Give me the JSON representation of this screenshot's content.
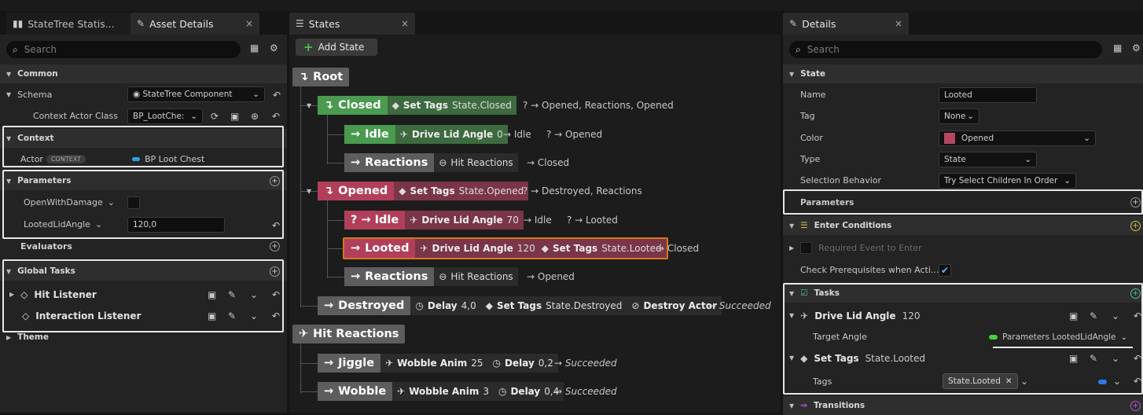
{
  "left_tabs": {
    "stats": "StateTree Statis...",
    "asset": "Asset Details",
    "close": "×"
  },
  "left": {
    "search_placeholder": "Search",
    "common": "Common",
    "schema_label": "Schema",
    "schema_value": "StateTree Component",
    "context_actor_class_label": "Context Actor Class",
    "context_actor_class_value": "BP_LootChe:",
    "context_section": "Context",
    "actor_label": "Actor",
    "actor_badge": "CONTEXT",
    "actor_value": "BP Loot Chest",
    "parameters_section": "Parameters",
    "open_with_damage": "OpenWithDamage",
    "looted_lid_angle": "LootedLidAngle",
    "looted_lid_angle_value": "120,0",
    "evaluators": "Evaluators",
    "global_tasks": "Global Tasks",
    "hit_listener": "Hit Listener",
    "interaction_listener": "Interaction Listener",
    "theme": "Theme"
  },
  "states_tab": {
    "title": "States",
    "close": "×",
    "add_state": "Add State"
  },
  "tree": {
    "root": "Root",
    "closed": "Closed",
    "closed_task": "Set Tags",
    "closed_task_val": "State.Closed",
    "closed_trans": "? → Opened, Reactions, Opened",
    "idle1": "Idle",
    "idle1_task": "Drive Lid Angle",
    "idle1_val": "0",
    "idle1_trans1": "→ Idle",
    "idle1_trans2": "? → Opened",
    "reactions1": "Reactions",
    "reactions1_task": "Hit Reactions",
    "reactions1_trans": "→ Closed",
    "opened": "Opened",
    "opened_task": "Set Tags",
    "opened_task_val": "State.Opened",
    "opened_trans": "? → Destroyed, Reactions",
    "idle2": "? → Idle",
    "idle2_task": "Drive Lid Angle",
    "idle2_val": "70",
    "idle2_trans1": "→ Idle",
    "idle2_trans2": "? → Looted",
    "looted": "Looted",
    "looted_task1": "Drive Lid Angle",
    "looted_task1_val": "120",
    "looted_task2": "Set Tags",
    "looted_task2_val": "State.Looted",
    "looted_trans": "→ Closed",
    "reactions2": "Reactions",
    "reactions2_task": "Hit Reactions",
    "reactions2_trans": "→ Opened",
    "destroyed": "Destroyed",
    "destroyed_delay": "Delay",
    "destroyed_delay_val": "4,0",
    "destroyed_task": "Set Tags",
    "destroyed_task_val": "State.Destroyed",
    "destroyed_task2": "Destroy Actor",
    "destroyed_trans": "→ Succeeded",
    "hit_reactions": "Hit Reactions",
    "jiggle": "Jiggle",
    "jiggle_task": "Wobble Anim",
    "jiggle_task_val": "25",
    "jiggle_delay": "Delay",
    "jiggle_delay_val": "0,2",
    "jiggle_trans": "→ Succeeded",
    "wobble": "Wobble",
    "wobble_task": "Wobble Anim",
    "wobble_task_val": "3",
    "wobble_delay": "Delay",
    "wobble_delay_val": "0,4",
    "wobble_trans": "→ Succeeded"
  },
  "details_tab": {
    "title": "Details",
    "close": "×"
  },
  "details": {
    "search_placeholder": "Search",
    "state_section": "State",
    "name_label": "Name",
    "name_value": "Looted",
    "tag_label": "Tag",
    "tag_value": "None",
    "color_label": "Color",
    "color_value": "Opened",
    "type_label": "Type",
    "type_value": "State",
    "selection_label": "Selection Behavior",
    "selection_value": "Try Select Children In Order",
    "parameters": "Parameters",
    "enter_conditions": "Enter Conditions",
    "required_event": "Required Event to Enter",
    "check_prereq": "Check Prerequisites when Acti...",
    "tasks": "Tasks",
    "task1": "Drive Lid Angle",
    "task1_val": "120",
    "target_angle": "Target Angle",
    "target_angle_value": "Parameters LootedLidAngle",
    "task2": "Set Tags",
    "task2_val": "State.Looted",
    "tags_label": "Tags",
    "tags_value": "State.Looted",
    "transitions": "Transitions"
  },
  "colors": {
    "green": "#4a9a4f",
    "red": "#b13f5a",
    "gray_state": "#5d5d5d",
    "orange": "#d7771f",
    "color_swatch": "#b4475f"
  }
}
